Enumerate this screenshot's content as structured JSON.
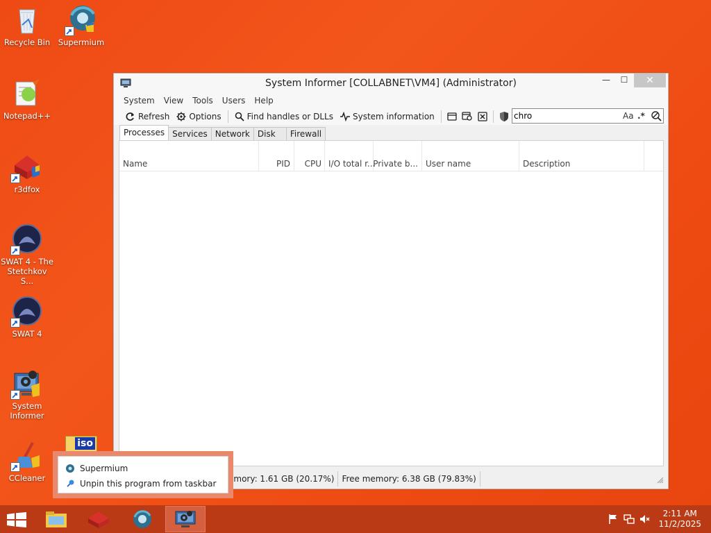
{
  "desktop": {
    "icons": [
      {
        "label": "Recycle Bin"
      },
      {
        "label": "Supermium"
      },
      {
        "label": "Notepad++"
      },
      {
        "label": "r3dfox"
      },
      {
        "label": "SWAT 4 - The Stetchkov S..."
      },
      {
        "label": "SWAT 4"
      },
      {
        "label": "System Informer"
      },
      {
        "label": "CCleaner"
      },
      {
        "label": "iso"
      }
    ]
  },
  "window": {
    "title": "System Informer [COLLABNET\\VM4] (Administrator)",
    "minimize": "—",
    "maximize": "☐",
    "close": "✕",
    "menu": [
      "System",
      "View",
      "Tools",
      "Users",
      "Help"
    ],
    "toolbar": {
      "refresh": "Refresh",
      "options": "Options",
      "find_handles": "Find handles or DLLs",
      "system_information": "System information"
    },
    "search": {
      "value": "chro",
      "case_option": "Aa",
      "regex_option": ".*"
    },
    "tabs": [
      "Processes",
      "Services",
      "Network",
      "Disk",
      "Firewall"
    ],
    "active_tab": "Processes",
    "columns": [
      "Name",
      "PID",
      "CPU",
      "I/O total r...",
      "Private b...",
      "User name",
      "Description"
    ],
    "status": {
      "physical_memory": "emory: 1.61 GB (20.17%)",
      "free_memory": "Free memory: 6.38 GB (79.83%)"
    }
  },
  "popup": {
    "items": [
      "Supermium",
      "Unpin this program from taskbar"
    ]
  },
  "taskbar": {
    "time": "2:11 AM",
    "date": "11/2/2025"
  },
  "colors": {
    "desktop": "#ef4a14",
    "taskbar": "#b93a14",
    "popup_border": "#e9886a"
  }
}
